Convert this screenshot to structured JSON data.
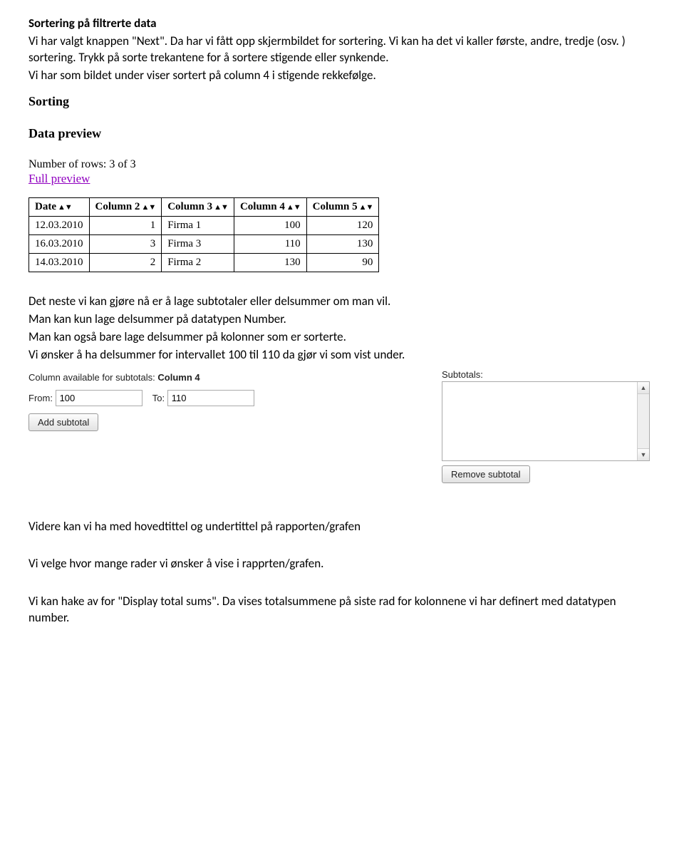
{
  "heading": "Sortering på filtrerte data",
  "intro": {
    "p1": "Vi har valgt knappen \"Next\". Da har vi fått opp skjermbildet for sortering. Vi kan ha det vi kaller første, andre, tredje (osv. ) sortering. Trykk på sorte trekantene for å sortere stigende eller synkende.",
    "p2": "Vi har som bildet under viser sortert på column 4 i stigende rekkefølge."
  },
  "ui1": {
    "sorting_label": "Sorting",
    "data_preview_label": "Data preview",
    "rows_label": "Number of rows: 3 of 3",
    "full_preview": "Full preview",
    "headers": [
      "Date",
      "Column 2",
      "Column 3",
      "Column 4",
      "Column 5"
    ],
    "rows": [
      {
        "date": "12.03.2010",
        "c2": "1",
        "c3": "Firma 1",
        "c4": "100",
        "c5": "120"
      },
      {
        "date": "16.03.2010",
        "c2": "3",
        "c3": "Firma 3",
        "c4": "110",
        "c5": "130"
      },
      {
        "date": "14.03.2010",
        "c2": "2",
        "c3": "Firma 2",
        "c4": "130",
        "c5": "90"
      }
    ]
  },
  "mid": {
    "p1": "Det neste vi kan gjøre nå er å lage subtotaler eller delsummer om man vil.",
    "p2": "Man kan kun lage delsummer på datatypen Number.",
    "p3": "Man kan også bare lage delsummer på kolonner som er sorterte.",
    "p4": "Vi ønsker å ha delsummer for intervallet 100 til 110 da gjør vi som vist under."
  },
  "ui2": {
    "col_avail_label": "Column available for subtotals:",
    "col_avail_value": "Column 4",
    "from_label": "From:",
    "from_value": "100",
    "to_label": "To:",
    "to_value": "110",
    "add_btn": "Add subtotal",
    "subtotals_label": "Subtotals:",
    "remove_btn": "Remove subtotal"
  },
  "outro": {
    "p1": "Videre kan vi ha med hovedtittel og undertittel på  rapporten/grafen",
    "p2": "Vi velge hvor mange rader vi ønsker å vise i rapprten/grafen.",
    "p3": "Vi kan hake av for \"Display total sums\". Da vises totalsummene på siste rad for kolonnene vi har definert med datatypen number."
  }
}
